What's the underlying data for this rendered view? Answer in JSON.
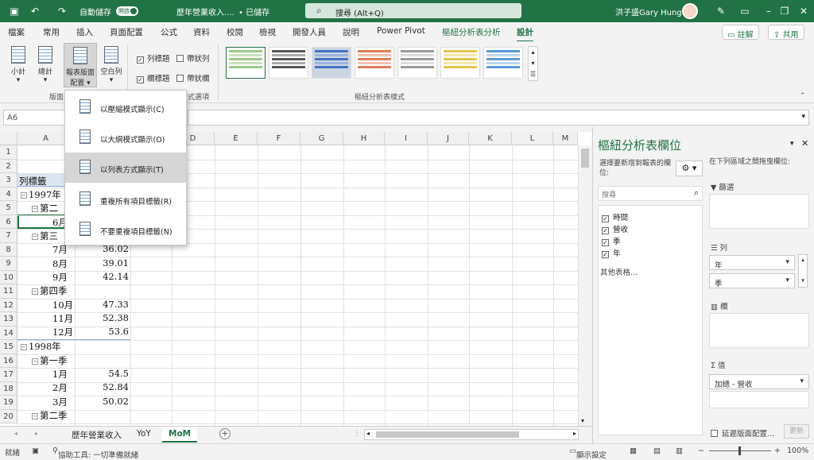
{
  "titlebar": {
    "autosave_label": "自動儲存",
    "autosave_state": "開啟",
    "filename": "歷年營業收入....",
    "save_status": "• 已儲存",
    "search_placeholder": "搜尋 (Alt+Q)",
    "user": "洪子盛Gary Hung"
  },
  "tabs": [
    "檔案",
    "常用",
    "插入",
    "頁面配置",
    "公式",
    "資料",
    "校閱",
    "檢視",
    "開發人員",
    "說明",
    "Power Pivot",
    "樞紐分析表分析",
    "設計"
  ],
  "comments_label": "註解",
  "share_label": "共用",
  "ribbon": {
    "subtotal": "小計",
    "grandtotal": "總計",
    "report_layout_line1": "報表版面",
    "report_layout_line2": "配置",
    "blank_rows": "空白列",
    "row_headers": "列標題",
    "banded_rows": "帶狀列",
    "col_headers": "欄標題",
    "banded_cols": "帶狀欄",
    "group_layout": "版面",
    "group_options": "式選項",
    "group_styles": "樞紐分析表樣式"
  },
  "formula_bar": {
    "namebox": "A6"
  },
  "dropdown": [
    {
      "label": "以壓縮模式顯示(C)",
      "highlight": false
    },
    {
      "label": "以大綱模式顯示(O)",
      "highlight": false
    },
    {
      "label": "以列表方式顯示(T)",
      "highlight": true
    },
    {
      "label": "重複所有項目標籤(R)",
      "highlight": false
    },
    {
      "label": "不要重複項目標籤(N)",
      "highlight": false
    }
  ],
  "grid": {
    "columns": [
      "A",
      "D",
      "E",
      "F",
      "G",
      "H",
      "I",
      "J",
      "K",
      "L",
      "M"
    ],
    "row_numbers": [
      "1",
      "2",
      "3",
      "4",
      "5",
      "6",
      "7",
      "8",
      "9",
      "10",
      "11",
      "12",
      "13",
      "14",
      "15",
      "16",
      "17",
      "18",
      "19",
      "20"
    ],
    "cells": {
      "r3": "列標籤",
      "r4": "1997年",
      "r5": "第二",
      "r6": "6月",
      "r7": "第三",
      "r8_label": "7月",
      "r8_val": "36.02",
      "r9_label": "8月",
      "r9_val": "39.01",
      "r10_label": "9月",
      "r10_val": "42.14",
      "r11": "第四季",
      "r12_label": "10月",
      "r12_val": "47.33",
      "r13_label": "11月",
      "r13_val": "52.38",
      "r14_label": "12月",
      "r14_val": "53.6",
      "r15": "1998年",
      "r16": "第一季",
      "r17_label": "1月",
      "r17_val": "54.5",
      "r18_label": "2月",
      "r18_val": "52.84",
      "r19_label": "3月",
      "r19_val": "50.02",
      "r20": "第二季"
    }
  },
  "pane": {
    "title": "樞紐分析表欄位",
    "choose_label": "選擇要新增到報表的欄位:",
    "drag_label": "在下列區域之間拖曳欄位:",
    "search_placeholder": "搜尋",
    "fields": [
      "時間",
      "營收",
      "季",
      "年"
    ],
    "more_tables": "其他表格...",
    "filters": "篩選",
    "rows": "列",
    "rows_items": [
      "年",
      "季"
    ],
    "columns": "欄",
    "values": "值",
    "values_items": [
      "加總 - 營收"
    ],
    "defer": "延遲版面配置...",
    "update": "更新"
  },
  "sheets": [
    "歷年營業收入",
    "YoY",
    "MoM"
  ],
  "status": {
    "ready": "就緒",
    "accessibility": "協助工具: 一切準備就緒",
    "display": "顯示設定",
    "zoom": "100%"
  }
}
